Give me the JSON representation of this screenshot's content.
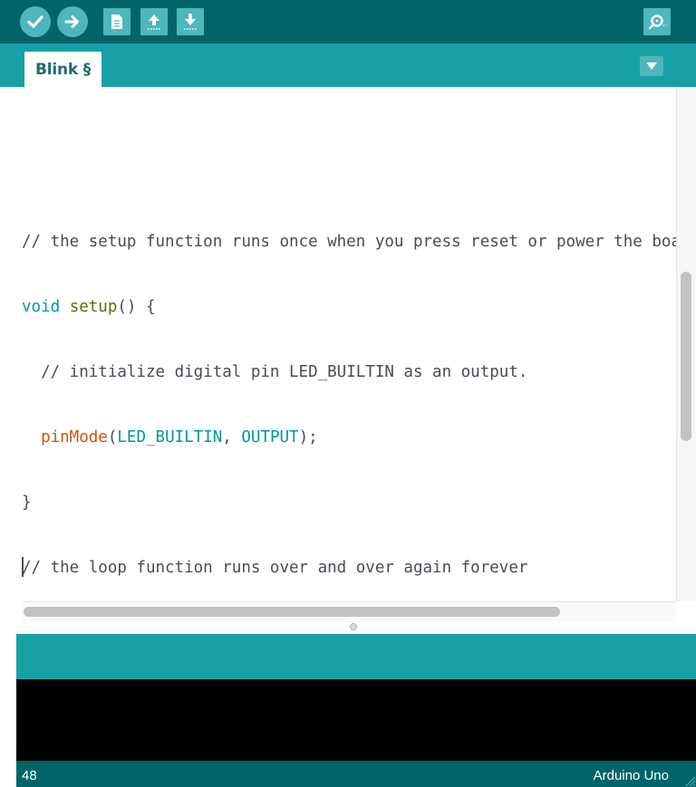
{
  "toolbar": {
    "buttons": [
      {
        "name": "verify",
        "icon": "checkmark-icon"
      },
      {
        "name": "upload",
        "icon": "arrow-right-icon"
      },
      {
        "name": "new",
        "icon": "new-file-icon"
      },
      {
        "name": "open",
        "icon": "open-up-arrow-icon"
      },
      {
        "name": "save",
        "icon": "save-down-arrow-icon"
      },
      {
        "name": "serial-monitor",
        "icon": "serial-monitor-magnifier-icon"
      }
    ]
  },
  "tabs": [
    {
      "label": "Blink §",
      "active": true
    }
  ],
  "tab_menu_icon": "triangle-down-icon",
  "editor": {
    "lines": [
      "// the setup function runs once when you press reset or power the board",
      "void setup() {",
      "  // initialize digital pin LED_BUILTIN as an output.",
      "  pinMode(LED_BUILTIN, OUTPUT);",
      "}",
      "// the loop function runs over and over again forever"
    ],
    "tokens": {
      "void": "void",
      "setup": "setup",
      "setup_rest": "() {",
      "indent": "  ",
      "pinMode": "pinMode",
      "paren_open": "(",
      "led_builtin": "LED_BUILTIN",
      "comma": ", ",
      "output": "OUTPUT",
      "paren_close": ");"
    }
  },
  "status": {
    "line_number": "48",
    "board": "Arduino Uno"
  },
  "colors": {
    "toolbar": "#006468",
    "tabbar": "#17a1a5",
    "button": "#4db7bb",
    "comment": "#434f54",
    "keyword": "#00979c",
    "function": "#5e6d03",
    "builtin": "#d35400"
  }
}
